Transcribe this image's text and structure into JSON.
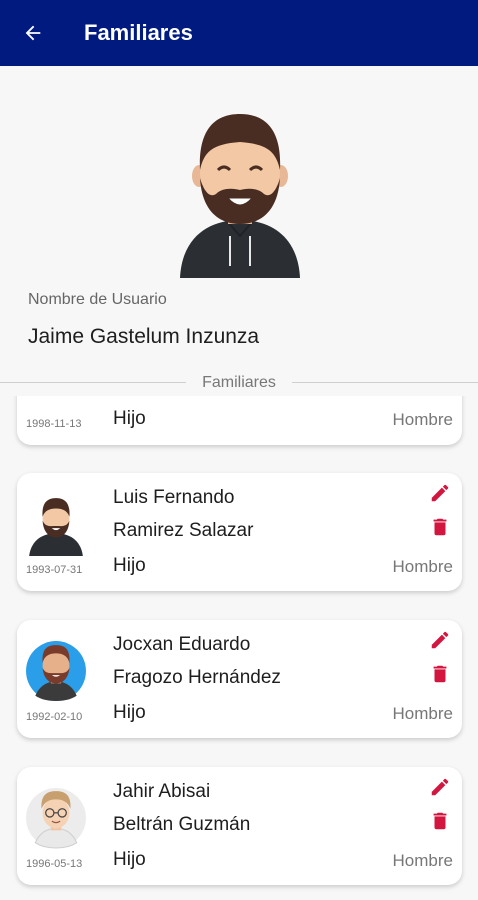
{
  "header": {
    "title": "Familiares",
    "back_icon": "arrow-left-icon",
    "background": "#001a80"
  },
  "profile": {
    "username_label": "Nombre de Usuario",
    "username": "Jaime Gastelum Inzunza",
    "avatar_icon": "bearded-man-avatar"
  },
  "section": {
    "label": "Familiares"
  },
  "colors": {
    "accent_red": "#d3163f"
  },
  "members": [
    {
      "first_name": "",
      "last_name": "",
      "birthdate": "1998-11-13",
      "relationship": "Hijo",
      "gender": "Hombre"
    },
    {
      "first_name": "Luis Fernando",
      "last_name": "Ramirez Salazar",
      "birthdate": "1993-07-31",
      "relationship": "Hijo",
      "gender": "Hombre"
    },
    {
      "first_name": "Jocxan Eduardo",
      "last_name": "Fragozo Hernández",
      "birthdate": "1992-02-10",
      "relationship": "Hijo",
      "gender": "Hombre"
    },
    {
      "first_name": "Jahir Abisai",
      "last_name": "Beltrán Guzmán",
      "birthdate": "1996-05-13",
      "relationship": "Hijo",
      "gender": "Hombre"
    }
  ]
}
